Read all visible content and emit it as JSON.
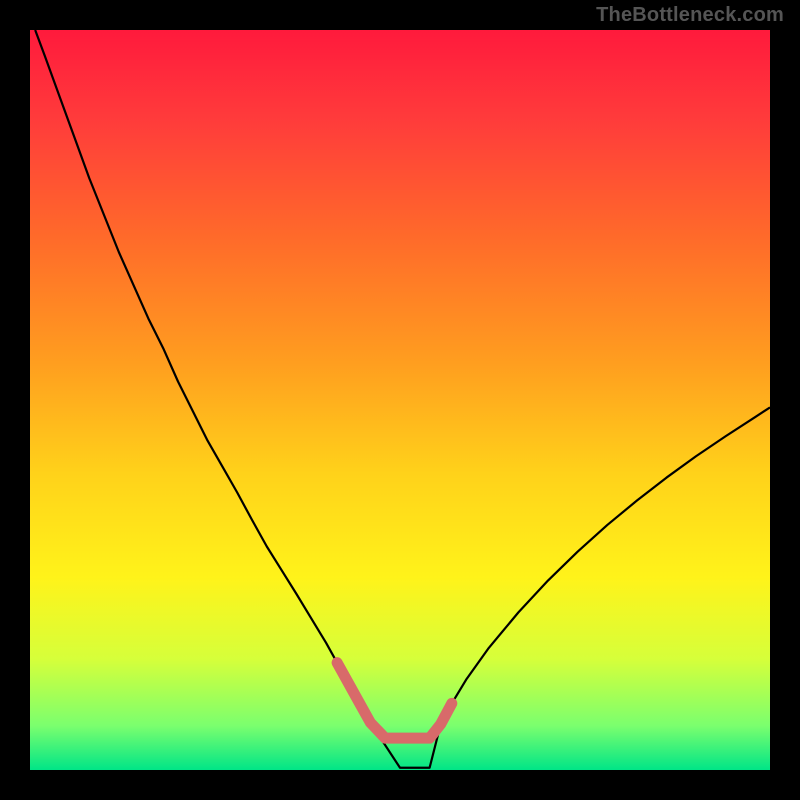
{
  "watermark": "TheBottleneck.com",
  "chart_data": {
    "type": "line",
    "title": "",
    "xlabel": "",
    "ylabel": "",
    "xlim": [
      0,
      100
    ],
    "ylim": [
      0,
      100
    ],
    "grid": false,
    "legend": false,
    "background_gradient": {
      "stops": [
        {
          "offset": 0.0,
          "color": "#ff1a3c"
        },
        {
          "offset": 0.12,
          "color": "#ff3b3b"
        },
        {
          "offset": 0.28,
          "color": "#ff6a2a"
        },
        {
          "offset": 0.45,
          "color": "#ff9e1f"
        },
        {
          "offset": 0.6,
          "color": "#ffd21a"
        },
        {
          "offset": 0.74,
          "color": "#fff31a"
        },
        {
          "offset": 0.85,
          "color": "#d6ff3a"
        },
        {
          "offset": 0.94,
          "color": "#7bff6e"
        },
        {
          "offset": 1.0,
          "color": "#00e587"
        }
      ]
    },
    "series": [
      {
        "name": "main-curve",
        "stroke": "#000000",
        "stroke_width": 2.2,
        "x": [
          0.7,
          2,
          4,
          6,
          8,
          10,
          12,
          14,
          16,
          18,
          20,
          22,
          24,
          26,
          28,
          30,
          32,
          34,
          36,
          38,
          40,
          41.5,
          43,
          44.5,
          46,
          50,
          54,
          55.5,
          57,
          59,
          62,
          66,
          70,
          74,
          78,
          82,
          86,
          90,
          94,
          98,
          100
        ],
        "y": [
          100,
          96.5,
          91,
          85.5,
          80,
          75,
          70,
          65.5,
          61,
          57,
          52.5,
          48.5,
          44.5,
          41,
          37.5,
          33.8,
          30.2,
          27,
          23.8,
          20.5,
          17.2,
          14.5,
          11.8,
          9.1,
          6.4,
          0.3,
          0.3,
          6.2,
          9.0,
          12.3,
          16.5,
          21.3,
          25.6,
          29.5,
          33.1,
          36.4,
          39.5,
          42.4,
          45.1,
          47.7,
          49.0
        ]
      },
      {
        "name": "bottom-u-marker",
        "stroke": "#d86a6a",
        "stroke_width": 11,
        "linecap": "round",
        "x": [
          41.5,
          43,
          44.5,
          46,
          48,
          50,
          52,
          54,
          55.5,
          57
        ],
        "y": [
          14.5,
          11.8,
          9.1,
          6.4,
          4.3,
          4.3,
          4.3,
          4.3,
          6.2,
          9.0
        ]
      }
    ]
  }
}
